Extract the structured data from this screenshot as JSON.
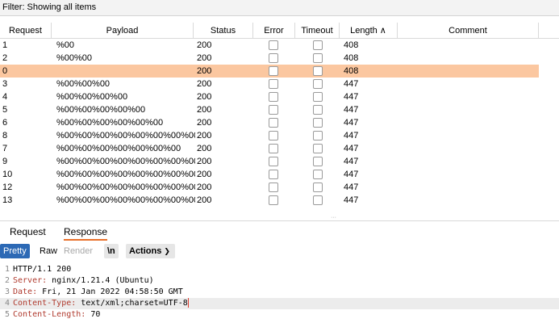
{
  "filter": {
    "label": "Filter: Showing all items"
  },
  "table": {
    "columns": [
      {
        "label": "Request"
      },
      {
        "label": "Payload"
      },
      {
        "label": "Status"
      },
      {
        "label": "Error"
      },
      {
        "label": "Timeout"
      },
      {
        "label": "Length ∧"
      },
      {
        "label": "Comment"
      }
    ],
    "rows": [
      {
        "request": "1",
        "payload": "%00",
        "status": "200",
        "length": "408"
      },
      {
        "request": "2",
        "payload": "%00%00",
        "status": "200",
        "length": "408"
      },
      {
        "request": "0",
        "payload": "",
        "status": "200",
        "length": "408",
        "selected": true
      },
      {
        "request": "3",
        "payload": "%00%00%00",
        "status": "200",
        "length": "447"
      },
      {
        "request": "4",
        "payload": "%00%00%00%00",
        "status": "200",
        "length": "447"
      },
      {
        "request": "5",
        "payload": "%00%00%00%00%00",
        "status": "200",
        "length": "447"
      },
      {
        "request": "6",
        "payload": "%00%00%00%00%00%00",
        "status": "200",
        "length": "447"
      },
      {
        "request": "8",
        "payload": "%00%00%00%00%00%00%00%00%...",
        "status": "200",
        "length": "447"
      },
      {
        "request": "7",
        "payload": "%00%00%00%00%00%00%00",
        "status": "200",
        "length": "447"
      },
      {
        "request": "9",
        "payload": "%00%00%00%00%00%00%00%00%...",
        "status": "200",
        "length": "447"
      },
      {
        "request": "10",
        "payload": "%00%00%00%00%00%00%00%00%...",
        "status": "200",
        "length": "447"
      },
      {
        "request": "12",
        "payload": "%00%00%00%00%00%00%00%00%...",
        "status": "200",
        "length": "447"
      },
      {
        "request": "13",
        "payload": "%00%00%00%00%00%00%00%00%...",
        "status": "200",
        "length": "447"
      }
    ]
  },
  "tabs": [
    {
      "label": "Request"
    },
    {
      "label": "Response",
      "active": true
    }
  ],
  "toolbar": {
    "pretty": "Pretty",
    "raw": "Raw",
    "render": "Render",
    "newline": "\\n",
    "actions": "Actions"
  },
  "response": {
    "lines": [
      {
        "num": "1",
        "key": "",
        "text": "HTTP/1.1 200"
      },
      {
        "num": "2",
        "key": "Server:",
        "text": " nginx/1.21.4 (Ubuntu)"
      },
      {
        "num": "3",
        "key": "Date:",
        "text": " Fri, 21 Jan 2022 04:58:50 GMT"
      },
      {
        "num": "4",
        "key": "Content-Type:",
        "text": " text/xml;charset=UTF-8",
        "highlight": true
      },
      {
        "num": "5",
        "key": "Content-Length:",
        "text": " 70"
      }
    ]
  },
  "colors": {
    "selected_row": "#fbc7a0",
    "accent": "#e8702a",
    "pretty_button": "#2c69b5",
    "header_key": "#b03a2e"
  }
}
